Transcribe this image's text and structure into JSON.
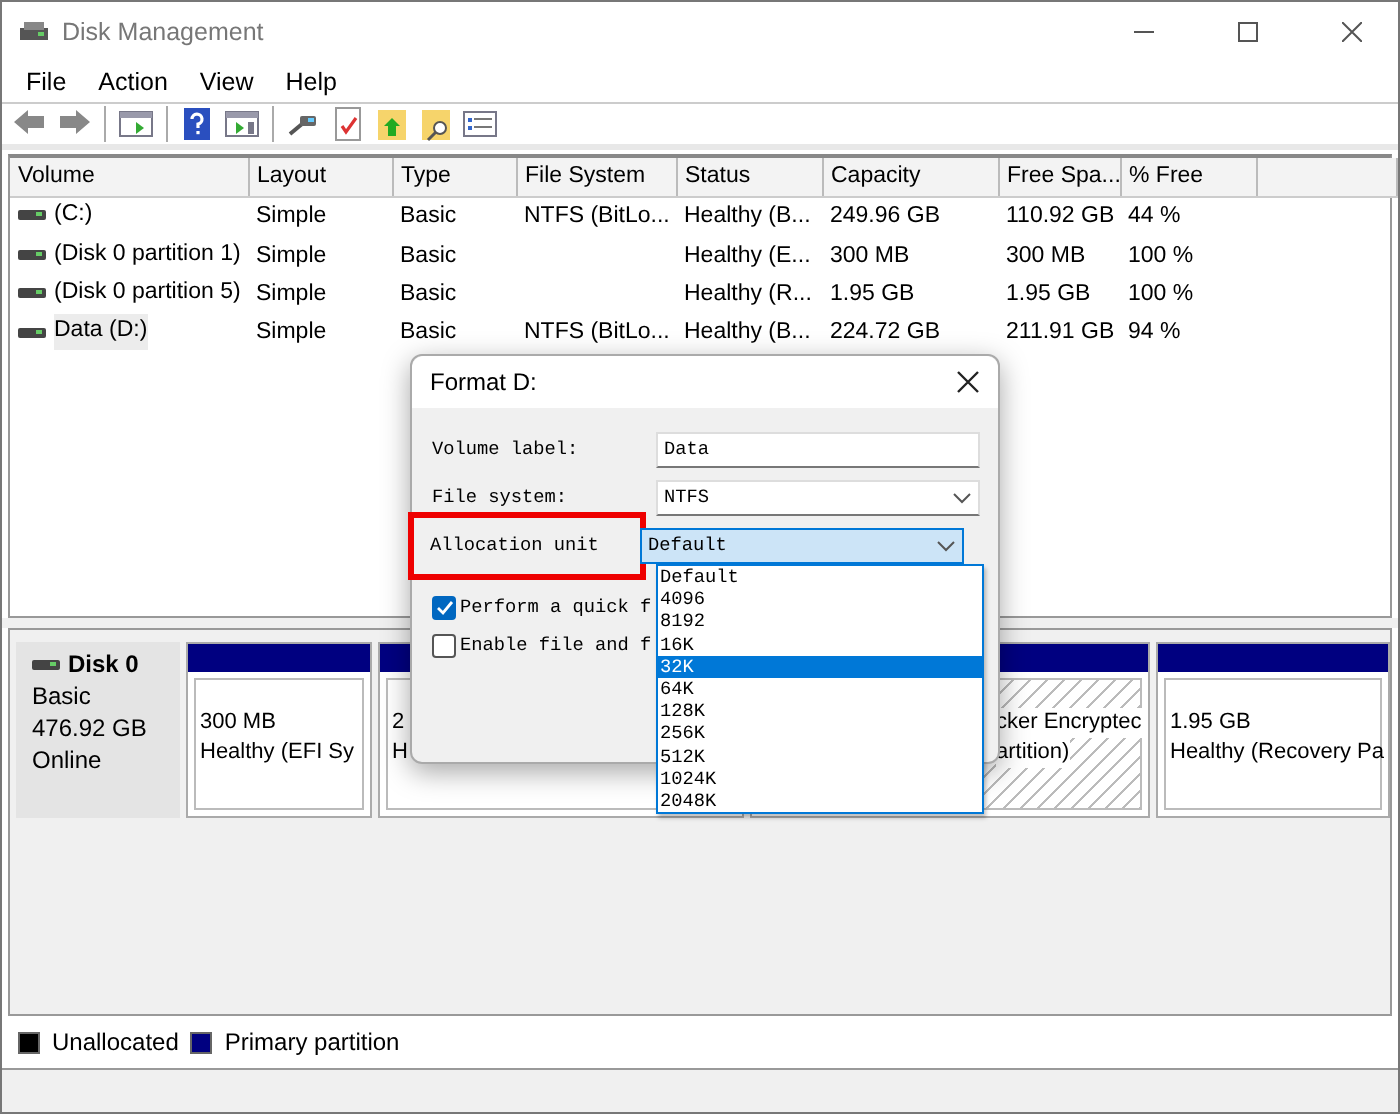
{
  "window": {
    "title": "Disk Management"
  },
  "menu": [
    "File",
    "Action",
    "View",
    "Help"
  ],
  "volumes": {
    "columns": [
      "Volume",
      "Layout",
      "Type",
      "File System",
      "Status",
      "Capacity",
      "Free Spa...",
      "% Free"
    ],
    "rows": [
      {
        "cells": [
          "(C:)",
          "Simple",
          "Basic",
          "NTFS (BitLo...",
          "Healthy (B...",
          "249.96 GB",
          "110.92 GB",
          "44 %"
        ],
        "selected": false
      },
      {
        "cells": [
          "(Disk 0 partition 1)",
          "Simple",
          "Basic",
          "",
          "Healthy (E...",
          "300 MB",
          "300 MB",
          "100 %"
        ],
        "selected": false
      },
      {
        "cells": [
          "(Disk 0 partition 5)",
          "Simple",
          "Basic",
          "",
          "Healthy (R...",
          "1.95 GB",
          "1.95 GB",
          "100 %"
        ],
        "selected": false
      },
      {
        "cells": [
          "Data (D:)",
          "Simple",
          "Basic",
          "NTFS (BitLo...",
          "Healthy (B...",
          "224.72 GB",
          "211.91 GB",
          "94 %"
        ],
        "selected": true
      }
    ]
  },
  "disk": {
    "name": "Disk 0",
    "type": "Basic",
    "size": "476.92 GB",
    "status": "Online",
    "partitions": [
      {
        "lines": [
          "300 MB",
          "Healthy (EFI Sy"
        ],
        "hatched": false
      },
      {
        "lines": [
          "2",
          "H"
        ],
        "hatched": false
      },
      {
        "lines": [
          "cker Encryptec",
          "artition)"
        ],
        "hatched": true
      },
      {
        "lines": [
          "1.95 GB",
          "Healthy (Recovery Pa"
        ],
        "hatched": false
      }
    ]
  },
  "legend": [
    {
      "label": "Unallocated",
      "color": "#000000"
    },
    {
      "label": "Primary partition",
      "color": "#000080"
    }
  ],
  "dialog": {
    "title": "Format D:",
    "fields": [
      {
        "label": "Volume label:",
        "kind": "text",
        "value": "Data",
        "highlighted": false
      },
      {
        "label": "File system:",
        "kind": "select",
        "value": "NTFS",
        "highlighted": false
      },
      {
        "label": "Allocation unit",
        "kind": "select",
        "value": "Default",
        "highlighted": true,
        "open": true
      }
    ],
    "options": [
      {
        "label": "Default",
        "selected": false
      },
      {
        "label": "4096",
        "selected": false
      },
      {
        "label": "8192",
        "selected": false
      },
      {
        "label": "16K",
        "selected": false
      },
      {
        "label": "32K",
        "selected": true
      },
      {
        "label": "64K",
        "selected": false
      },
      {
        "label": "128K",
        "selected": false
      },
      {
        "label": "256K",
        "selected": false
      },
      {
        "label": "512K",
        "selected": false
      },
      {
        "label": "1024K",
        "selected": false
      },
      {
        "label": "2048K",
        "selected": false
      }
    ],
    "checkboxes": [
      {
        "label": "Perform a quick f",
        "checked": true
      },
      {
        "label": "Enable file and f",
        "checked": false
      }
    ]
  }
}
